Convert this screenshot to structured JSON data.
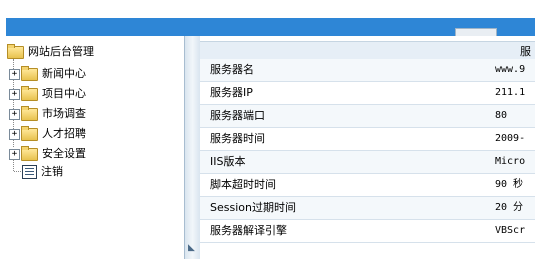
{
  "header": {
    "tabs_label": ""
  },
  "tree": {
    "root": "网站后台管理",
    "items": [
      {
        "label": "新闻中心",
        "type": "folder"
      },
      {
        "label": "项目中心",
        "type": "folder"
      },
      {
        "label": "市场调查",
        "type": "folder"
      },
      {
        "label": "人才招聘",
        "type": "folder"
      },
      {
        "label": "安全设置",
        "type": "folder"
      },
      {
        "label": "注销",
        "type": "doc"
      }
    ]
  },
  "table": {
    "header": "服",
    "rows": [
      {
        "key": "服务器名",
        "value": "www.9"
      },
      {
        "key": "服务器IP",
        "value": "211.1"
      },
      {
        "key": "服务器端口",
        "value": "80"
      },
      {
        "key": "服务器时间",
        "value": "2009-"
      },
      {
        "key": "IIS版本",
        "value": "Micro"
      },
      {
        "key": "脚本超时时间",
        "value": "90 秒"
      },
      {
        "key": "Session过期时间",
        "value": "20 分"
      },
      {
        "key": "服务器解译引擎",
        "value": "VBScr"
      }
    ]
  }
}
